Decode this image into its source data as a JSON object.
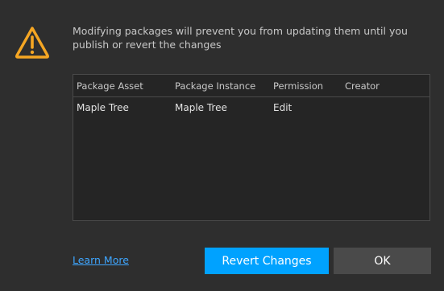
{
  "dialog": {
    "message": "Modifying packages will prevent you from updating them until you publish or revert the changes",
    "icon": "warning-icon",
    "accent_color": "#f5a623"
  },
  "table": {
    "headers": [
      "Package Asset",
      "Package Instance",
      "Permission",
      "Creator"
    ],
    "rows": [
      [
        "Maple Tree",
        "Maple Tree",
        "Edit",
        ""
      ]
    ]
  },
  "footer": {
    "learn_more": "Learn More",
    "revert_label": "Revert Changes",
    "ok_label": "OK",
    "primary_color": "#00a2ff",
    "link_color": "#3ea6ff"
  }
}
